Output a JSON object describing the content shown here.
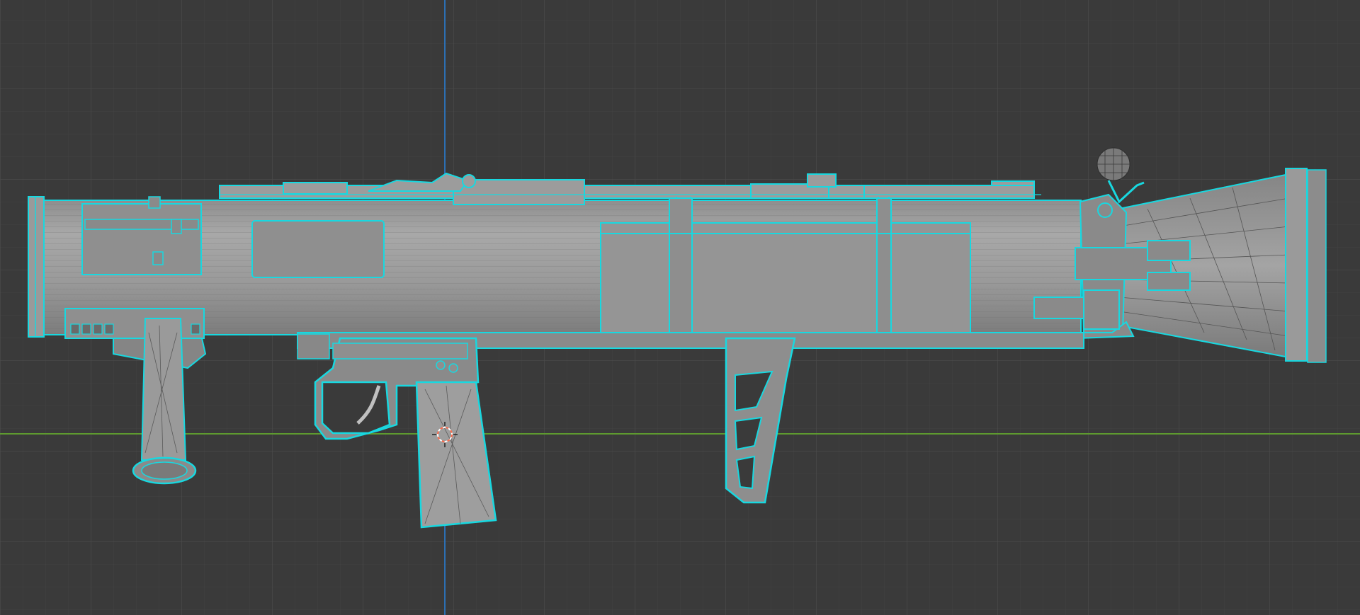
{
  "viewport": {
    "background": "#3a3a3a",
    "grid_minor_color": "#434343",
    "grid_major_color": "#4e4e4e",
    "x_axis_color": "#5e9a2f",
    "z_axis_color": "#2c6fb3",
    "mesh_fill": "#9a9a9a",
    "mesh_shadow": "#7f7f7f",
    "wire_color": "#2c2c2c",
    "selection_outline_color": "#18d8e0",
    "cursor_icon": "3d-cursor-icon",
    "object": "recoilless-launcher-mesh"
  }
}
